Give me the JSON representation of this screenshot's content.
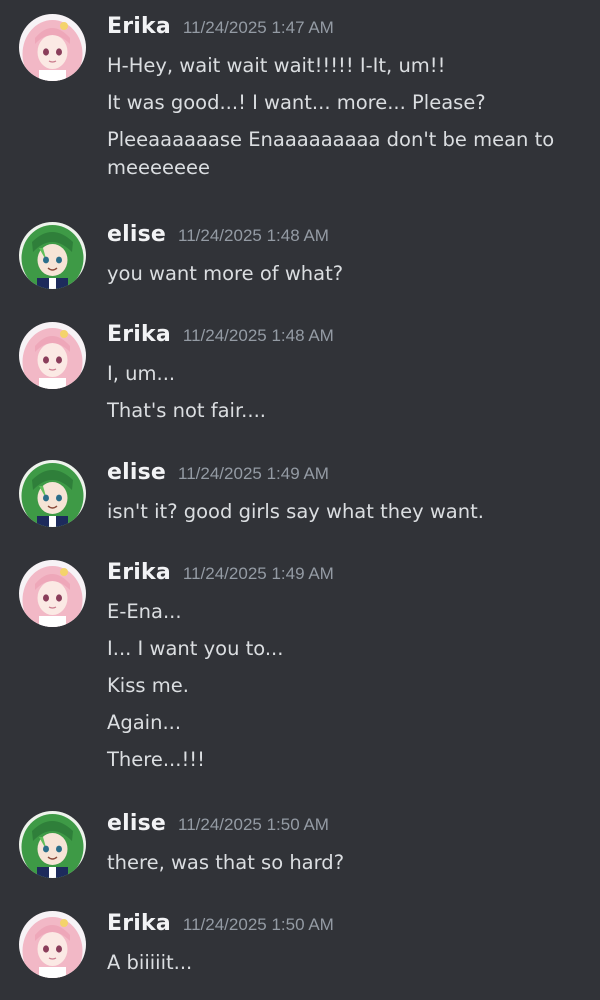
{
  "colors": {
    "background": "#313338",
    "username": "#f2f3f5",
    "timestamp": "#949ba4",
    "message_text": "#dbdee1"
  },
  "messages": [
    {
      "author": "Erika",
      "avatar": "erika-avatar",
      "timestamp": "11/24/2025 1:47 AM",
      "lines": [
        "H-Hey, wait wait wait!!!!! I-It, um!!",
        "It was good...! I want... more... Please?",
        "Pleeaaaaaase Enaaaaaaaaa don't be mean to",
        "meeeeeee"
      ]
    },
    {
      "author": "elise",
      "avatar": "elise-avatar",
      "timestamp": "11/24/2025 1:48 AM",
      "lines": [
        "you want more of what?"
      ]
    },
    {
      "author": "Erika",
      "avatar": "erika-avatar",
      "timestamp": "11/24/2025 1:48 AM",
      "lines": [
        "I, um...",
        "That's not fair...."
      ]
    },
    {
      "author": "elise",
      "avatar": "elise-avatar",
      "timestamp": "11/24/2025 1:49 AM",
      "lines": [
        "isn't it? good girls say what they want."
      ]
    },
    {
      "author": "Erika",
      "avatar": "erika-avatar",
      "timestamp": "11/24/2025 1:49 AM",
      "lines": [
        "E-Ena...",
        "I... I want you to...",
        "Kiss me.",
        "Again...",
        "There...!!!"
      ]
    },
    {
      "author": "elise",
      "avatar": "elise-avatar",
      "timestamp": "11/24/2025 1:50 AM",
      "lines": [
        "there, was that so hard?"
      ]
    },
    {
      "author": "Erika",
      "avatar": "erika-avatar",
      "timestamp": "11/24/2025 1:50 AM",
      "lines": [
        "A biiiiit..."
      ]
    }
  ]
}
